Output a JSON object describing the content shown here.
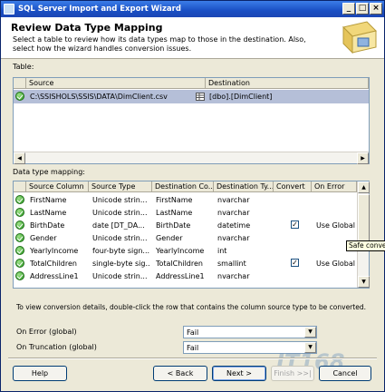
{
  "window": {
    "title": "SQL Server Import and Export Wizard",
    "controls": [
      "_",
      "□",
      "×"
    ]
  },
  "header": {
    "title": "Review Data Type Mapping",
    "description": "Select a table to review how its data types map to those in the destination. Also, select how the wizard handles conversion issues."
  },
  "table_section": {
    "label": "Table:",
    "columns": [
      "Source",
      "Destination"
    ],
    "rows": [
      {
        "source": "C:\\SSISHOLS\\SSIS\\DATA\\DimClient.csv",
        "destination": "[dbo].[DimClient]"
      }
    ]
  },
  "mapping_section": {
    "label": "Data type mapping:",
    "columns": [
      "Source Column",
      "Source Type",
      "Destination Co...",
      "Destination Ty...",
      "Convert",
      "On Error"
    ],
    "rows": [
      {
        "source_column": "FirstName",
        "source_type": "Unicode strin...",
        "dest_column": "FirstName",
        "dest_type": "nvarchar",
        "convert": "",
        "on_error": ""
      },
      {
        "source_column": "LastName",
        "source_type": "Unicode strin...",
        "dest_column": "LastName",
        "dest_type": "nvarchar",
        "convert": "",
        "on_error": ""
      },
      {
        "source_column": "BirthDate",
        "source_type": "date [DT_DA...",
        "dest_column": "BirthDate",
        "dest_type": "datetime",
        "convert": "✓",
        "on_error": "Use Global"
      },
      {
        "source_column": "Gender",
        "source_type": "Unicode strin...",
        "dest_column": "Gender",
        "dest_type": "nvarchar",
        "convert": "",
        "on_error": ""
      },
      {
        "source_column": "YearlyIncome",
        "source_type": "four-byte sign...",
        "dest_column": "YearlyIncome",
        "dest_type": "int",
        "convert": "",
        "on_error": ""
      },
      {
        "source_column": "TotalChildren",
        "source_type": "single-byte sig...",
        "dest_column": "TotalChildren",
        "dest_type": "smallint",
        "convert": "✓",
        "on_error": "Use Global"
      },
      {
        "source_column": "AddressLine1",
        "source_type": "Unicode strin...",
        "dest_column": "AddressLine1",
        "dest_type": "nvarchar",
        "convert": "",
        "on_error": ""
      }
    ],
    "tooltip": "Safe conversion",
    "hint": "To view conversion details, double-click the row that contains the column source type to be converted."
  },
  "global_options": {
    "on_error_label": "On Error (global)",
    "on_error_value": "Fail",
    "on_truncation_label": "On Truncation (global)",
    "on_truncation_value": "Fail"
  },
  "buttons": {
    "help": "Help",
    "back": "< Back",
    "next": "Next >",
    "finish": "Finish >>|",
    "cancel": "Cancel"
  },
  "watermark": "IT168",
  "colors": {
    "titlebar": "#1a4fc4",
    "selection": "#b5bfd8",
    "panel_border": "#7f9db9",
    "ok_icon": "#2a9a20"
  }
}
